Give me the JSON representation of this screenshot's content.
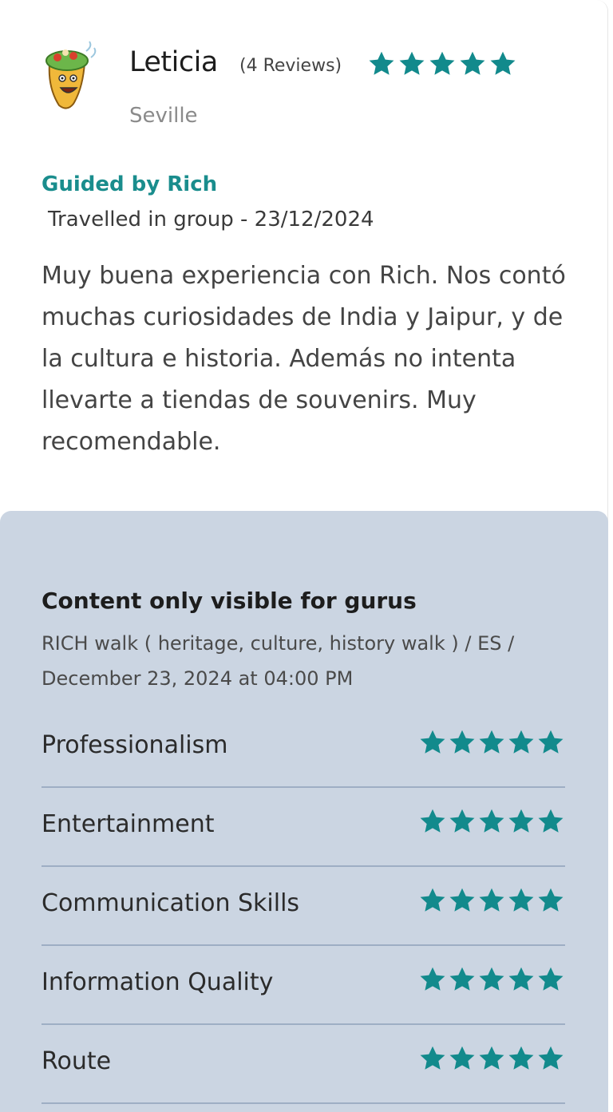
{
  "review": {
    "reviewer_name": "Leticia",
    "review_count": "(4 Reviews)",
    "rating": 5,
    "city": "Seville",
    "guided_by": "Guided by Rich",
    "travel_info": "Travelled in group - 23/12/2024",
    "text": "Muy buena experiencia con Rich. Nos contó muchas curiosidades de India y Jaipur, y de la cultura e historia. Además no intenta llevarte a tiendas de souvenirs. Muy recomendable."
  },
  "guru_panel": {
    "title": "Content only visible for gurus",
    "detail": "RICH walk ( heritage, culture, history walk ) / ES / December 23, 2024 at 04:00 PM",
    "ratings": [
      {
        "label": "Professionalism",
        "stars": 5
      },
      {
        "label": "Entertainment",
        "stars": 5
      },
      {
        "label": "Communication Skills",
        "stars": 5
      },
      {
        "label": "Information Quality",
        "stars": 5
      },
      {
        "label": "Route",
        "stars": 5
      }
    ]
  },
  "colors": {
    "accent": "#1a8d8d",
    "star": "#128a8c",
    "panel_bg": "#cbd5e2"
  },
  "icons": {
    "avatar": "cartoon-burrito-avatar",
    "star": "star-icon"
  }
}
